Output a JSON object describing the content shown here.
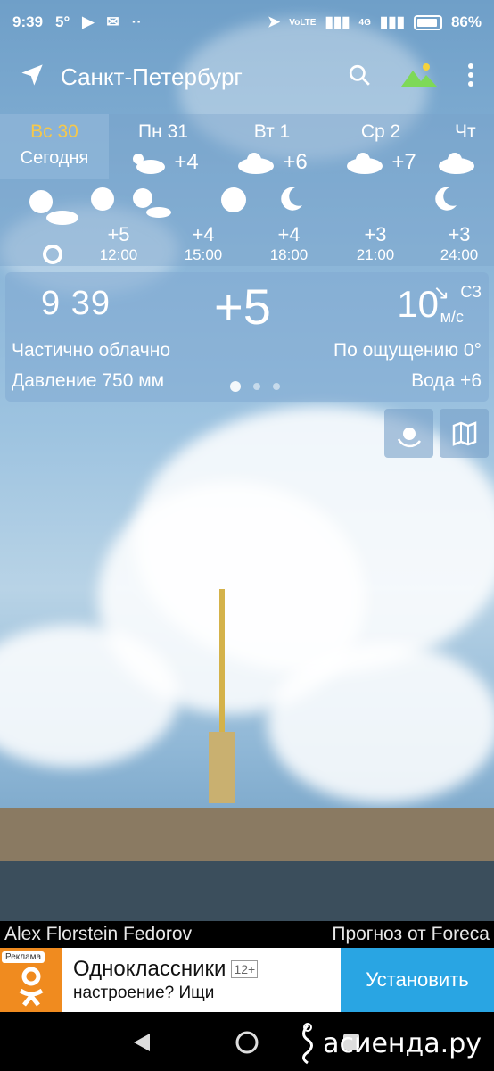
{
  "status": {
    "time": "9:39",
    "temp": "5°",
    "battery": "86%",
    "network": "4G"
  },
  "header": {
    "city": "Санкт-Петербург"
  },
  "days": [
    {
      "name": "Вс 30",
      "sub": "Сегодня"
    },
    {
      "name": "Пн 31",
      "temp": "+4"
    },
    {
      "name": "Вт 1",
      "temp": "+6"
    },
    {
      "name": "Ср 2",
      "temp": "+7"
    },
    {
      "name": "Чт"
    }
  ],
  "hours": [
    {
      "time": "12:00",
      "temp": "+5"
    },
    {
      "time": "15:00",
      "temp": "+4"
    },
    {
      "time": "18:00",
      "temp": "+4"
    },
    {
      "time": "21:00",
      "temp": "+3"
    },
    {
      "time": "24:00",
      "temp": "+3"
    }
  ],
  "current": {
    "time": "9 39",
    "temp": "+5",
    "wind_speed": "10",
    "wind_unit": "м/с",
    "wind_dir": "СЗ",
    "condition": "Частично облачно",
    "feels_like": "По ощущению 0°",
    "pressure": "Давление 750 мм",
    "water": "Вода +6"
  },
  "credits": {
    "author": "Alex Florstein Fedorov",
    "source": "Прогноз от Foreca"
  },
  "ad": {
    "label": "Реклама",
    "title": "Одноклассники",
    "age": "12+",
    "subtitle": "настроение? Ищи",
    "button": "Установить"
  },
  "watermark": "асиенда.ру"
}
